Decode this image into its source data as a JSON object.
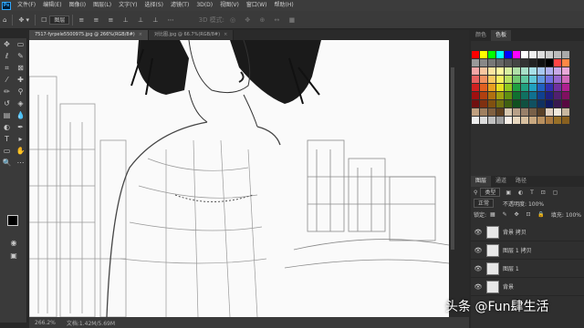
{
  "app": {
    "logo": "Ps"
  },
  "menu": [
    "文件(F)",
    "编辑(E)",
    "图像(I)",
    "图层(L)",
    "文字(Y)",
    "选择(S)",
    "滤镜(T)",
    "3D(D)",
    "视图(V)",
    "窗口(W)",
    "帮助(H)"
  ],
  "options": {
    "mode_label": "图层",
    "mode3d": "3D 模式:"
  },
  "tabs": [
    {
      "label": "7517-fyrpele5500975.jpg @ 266%(RGB/8#)",
      "close": "×"
    },
    {
      "label": "对比图.jpg @ 66.7%(RGB/8#)",
      "close": "×"
    }
  ],
  "status": {
    "zoom": "266.2%",
    "doc": "文档:1.42M/5.69M"
  },
  "right_panel": {
    "top_tabs": [
      "颜色",
      "色板"
    ],
    "layer_tabs": [
      "图层",
      "通道",
      "路径"
    ],
    "filter": "类型",
    "blend": "正常",
    "opacity": "不透明度: 100%",
    "lock": "锁定:",
    "fill": "填充: 100%",
    "layers": [
      {
        "name": "背景 拷贝"
      },
      {
        "name": "图层 1 拷贝"
      },
      {
        "name": "图层 1"
      },
      {
        "name": "背景"
      }
    ]
  },
  "palette_colors": [
    [
      "#ff0000",
      "#ffff00",
      "#00ff00",
      "#00ffff",
      "#0000ff",
      "#ff00ff",
      "#ffffff",
      "#eeeeee",
      "#dddddd",
      "#cccccc",
      "#bbbbbb",
      "#aaaaaa"
    ],
    [
      "#999999",
      "#888888",
      "#777777",
      "#666666",
      "#555555",
      "#444444",
      "#333333",
      "#222222",
      "#111111",
      "#000000",
      "#ff4444",
      "#ff8844"
    ],
    [
      "#f4a6a6",
      "#f8c6a0",
      "#fbe5a0",
      "#fffaa0",
      "#d8f0a0",
      "#b0e0a8",
      "#a8e0c8",
      "#a8e0e8",
      "#a8c8f0",
      "#b0b0f0",
      "#c8a8e8",
      "#e8a8d8"
    ],
    [
      "#e86060",
      "#f09060",
      "#f8c860",
      "#f8f060",
      "#b8e060",
      "#70c870",
      "#60c8a0",
      "#60c8d8",
      "#6098e0",
      "#7070e0",
      "#9868d0",
      "#d068b8"
    ],
    [
      "#d02020",
      "#e06020",
      "#e8a020",
      "#e8e020",
      "#90c820",
      "#20a040",
      "#20a080",
      "#20a0c0",
      "#2060c0",
      "#3030b0",
      "#7030a0",
      "#b02090"
    ],
    [
      "#a01010",
      "#b04010",
      "#b07010",
      "#a0a010",
      "#609010",
      "#107030",
      "#107060",
      "#107090",
      "#104090",
      "#202080",
      "#502070",
      "#801060"
    ],
    [
      "#701010",
      "#803010",
      "#805010",
      "#707010",
      "#406010",
      "#105020",
      "#105040",
      "#105060",
      "#103060",
      "#101860",
      "#381850",
      "#580840"
    ],
    [
      "#c0a080",
      "#a08060",
      "#806040",
      "#604020",
      "#d8c8b0",
      "#b8a088",
      "#98806a",
      "#786048",
      "#584028",
      "#e0d0c0",
      "#f0e8dc",
      "#c8b8a0"
    ],
    [
      "#eeeeee",
      "#dcdcdc",
      "#c0c0c0",
      "#a0a0a0",
      "#f8f0e8",
      "#e8d8c0",
      "#d8c0a0",
      "#c8a880",
      "#b89060",
      "#a87840",
      "#987028",
      "#886020"
    ]
  ],
  "watermark": "头条 @Fun肆生活"
}
